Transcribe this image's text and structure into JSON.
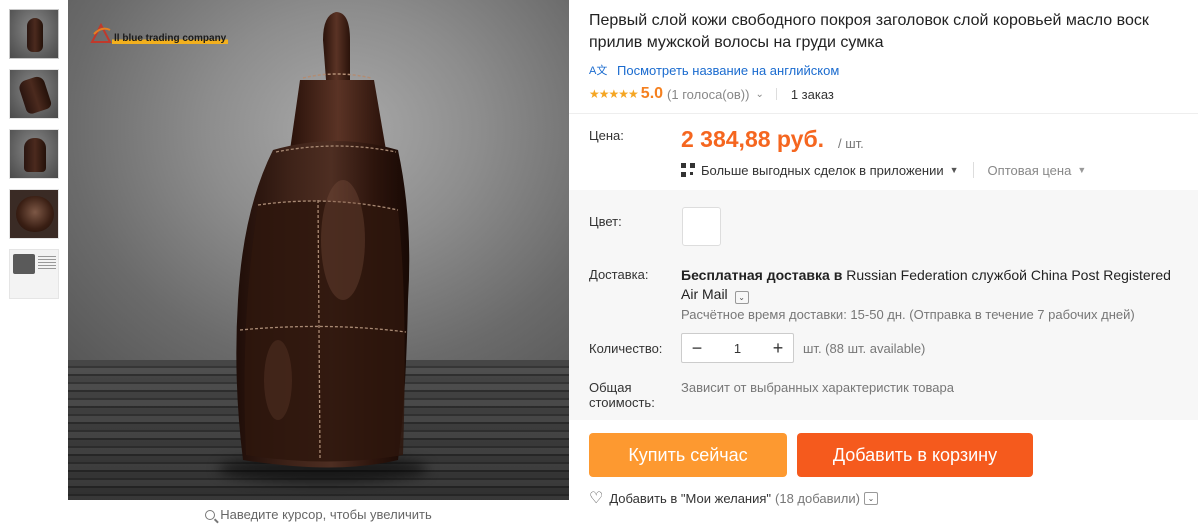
{
  "thumbnails": [
    {
      "name": "thumb-1"
    },
    {
      "name": "thumb-2"
    },
    {
      "name": "thumb-3"
    },
    {
      "name": "thumb-4"
    },
    {
      "name": "thumb-5"
    }
  ],
  "image": {
    "logo_text": "ll blue trading company",
    "zoom_hint": "Наведите курсор, чтобы увеличить"
  },
  "product": {
    "title": "Первый слой кожи свободного покроя заголовок слой коровьей масло воск прилив мужской волосы на груди сумка",
    "translate_icon_text": "A文",
    "translate_link": "Посмотреть название на английском",
    "rating_stars": "★★★★★",
    "rating_value": "5.0",
    "votes": "(1 голоса(ов))",
    "orders": "1 заказ"
  },
  "price": {
    "label": "Цена:",
    "value": "2 384,88 руб.",
    "unit": "/ шт.",
    "deals_label": "Больше выгодных сделок в приложении",
    "wholesale_label": "Оптовая цена"
  },
  "options": {
    "color_label": "Цвет:",
    "delivery_label": "Доставка:",
    "delivery_bold": "Бесплатная доставка в",
    "delivery_rest": " Russian Federation службой China Post Registered Air Mail",
    "delivery_time": "Расчётное время доставки: 15-50 дн. (Отправка в течение 7 рабочих дней)",
    "quantity_label": "Количество:",
    "quantity_minus": "−",
    "quantity_value": "1",
    "quantity_plus": "+",
    "available": "шт. (88 шт. available)",
    "total_label": "Общая стоимость:",
    "total_value": "Зависит от выбранных характеристик товара"
  },
  "actions": {
    "buy_now": "Купить сейчас",
    "add_to_cart": "Добавить в корзину",
    "wishlist": "Добавить в \"Мои желания\"",
    "wishlist_count": "(18 добавили)"
  },
  "colors": {
    "price": "#f5661f",
    "buy_button": "#fd9930",
    "cart_button": "#f55a1d",
    "link": "#1a6bcf",
    "star": "#f5a623"
  }
}
